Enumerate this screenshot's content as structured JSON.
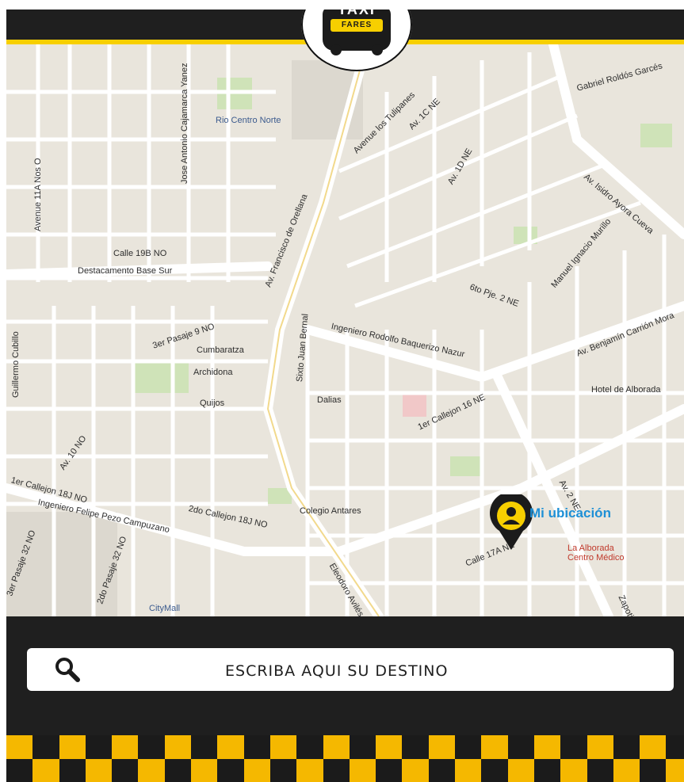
{
  "logo": {
    "top_text": "TAXI",
    "badge_text": "FARES"
  },
  "map": {
    "labels": [
      {
        "text": "Gabriel Roldós Garcés",
        "kind": "street"
      },
      {
        "text": "Av. Francisco de Orellana",
        "kind": "street"
      },
      {
        "text": "Avenue los Tulipanes",
        "kind": "street"
      },
      {
        "text": "Av. 1C NE",
        "kind": "street"
      },
      {
        "text": "Av. 1D NE",
        "kind": "street"
      },
      {
        "text": "Rio Centro Norte",
        "kind": "poi"
      },
      {
        "text": "Jose Antonio Cajamarca Yanez",
        "kind": "street"
      },
      {
        "text": "Avenue 11A Nos O",
        "kind": "street"
      },
      {
        "text": "Calle 19B NO",
        "kind": "street"
      },
      {
        "text": "Destacamento Base Sur",
        "kind": "street"
      },
      {
        "text": "Manuel Ignacio Murillo",
        "kind": "street"
      },
      {
        "text": "Av. Isidro Ayora Cueva",
        "kind": "street"
      },
      {
        "text": "6to Pje. 2 NE",
        "kind": "street"
      },
      {
        "text": "Ingeniero Rodolfo Baquerizo Nazur",
        "kind": "street"
      },
      {
        "text": "Av. Benjamín Carrión Mora",
        "kind": "street"
      },
      {
        "text": "3er Pasaje 9 NO",
        "kind": "street"
      },
      {
        "text": "Cumbaratza",
        "kind": "street"
      },
      {
        "text": "Archidona",
        "kind": "street"
      },
      {
        "text": "Quijos",
        "kind": "street"
      },
      {
        "text": "Dalias",
        "kind": "street"
      },
      {
        "text": "1er Callejon 16 NE",
        "kind": "street"
      },
      {
        "text": "Hotel de Alborada",
        "kind": "poi"
      },
      {
        "text": "Sixto Juan Bernal",
        "kind": "street"
      },
      {
        "text": "Guillermo Cubillo",
        "kind": "street"
      },
      {
        "text": "Av. 10 NO",
        "kind": "street"
      },
      {
        "text": "1er Callejon 18J NO",
        "kind": "street"
      },
      {
        "text": "Ingeniero Felipe Pezo Campuzano",
        "kind": "street"
      },
      {
        "text": "2do Callejon 18J NO",
        "kind": "street"
      },
      {
        "text": "Colegio Antares",
        "kind": "poi"
      },
      {
        "text": "Calle 17A NE",
        "kind": "street"
      },
      {
        "text": "La Alborada Centro Médico",
        "kind": "poi"
      },
      {
        "text": "Av. 2 NE",
        "kind": "street"
      },
      {
        "text": "Zapotillo",
        "kind": "street"
      },
      {
        "text": "Eleodoro Avilés Mi",
        "kind": "street"
      },
      {
        "text": "3er Pasaje 32 NO",
        "kind": "street"
      },
      {
        "text": "2do Pasaje 32 NO",
        "kind": "street"
      },
      {
        "text": "CityMall",
        "kind": "poi"
      }
    ],
    "my_location_label": "Mi ubicación"
  },
  "search": {
    "placeholder": "ESCRIBA AQUI SU DESTINO"
  },
  "colors": {
    "accent": "#f7cf00",
    "bar": "#1f1f1f",
    "map_bg": "#e9e5dc",
    "location_blue": "#1e90d6"
  }
}
